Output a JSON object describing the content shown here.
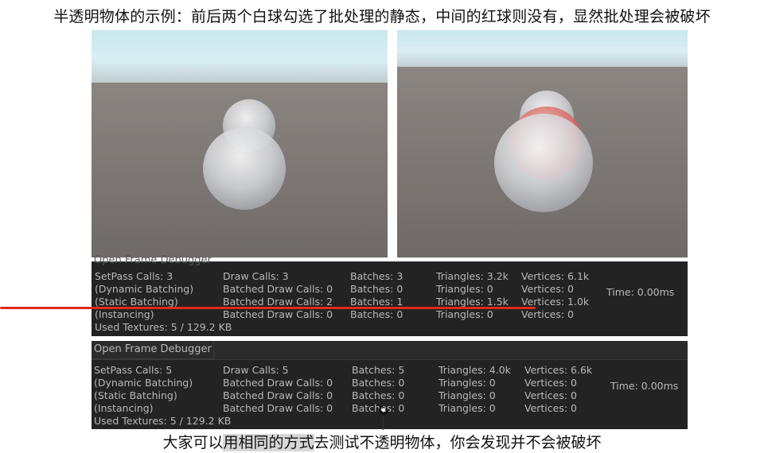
{
  "caption_top": "半透明物体的示例：前后两个白球勾选了批处理的静态，中间的红球则没有，显然批处理会被破坏",
  "caption_bottom": {
    "before": "大家可以",
    "highlight": "用相同的方式",
    "after": "去测试不透明物体，你会发现并不会被破坏"
  },
  "stats_panels": [
    {
      "header": "Open Frame Debugger",
      "rows": [
        [
          "SetPass Calls: 3",
          "Draw Calls: 3",
          "Batches: 3",
          "Triangles: 3.2k",
          "Vertices: 6.1k",
          ""
        ],
        [
          "(Dynamic Batching)",
          "Batched Draw Calls: 0",
          "Batches: 0",
          "Triangles: 0",
          "Vertices: 0",
          "Time: 0.00ms"
        ],
        [
          "(Static Batching)",
          "Batched Draw Calls: 2",
          "Batches: 1",
          "Triangles: 1.5k",
          "Vertices: 1.0k",
          ""
        ],
        [
          "(Instancing)",
          "Batched Draw Calls: 0",
          "Batches: 0",
          "Triangles: 0",
          "Vertices: 0",
          ""
        ],
        [
          "Used Textures: 5 / 129.2 KB",
          "",
          "",
          "",
          "",
          ""
        ]
      ]
    },
    {
      "header": "Open Frame Debugger",
      "rows": [
        [
          "SetPass Calls: 5",
          "Draw Calls: 5",
          "Batches: 5",
          "Triangles: 4.0k",
          "Vertices: 6.6k",
          ""
        ],
        [
          "(Dynamic Batching)",
          "Batched Draw Calls: 0",
          "Batches: 0",
          "Triangles: 0",
          "Vertices: 0",
          "Time: 0.00ms"
        ],
        [
          "(Static Batching)",
          "Batched Draw Calls: 0",
          "Batches: 0",
          "Triangles: 0",
          "Vertices: 0",
          ""
        ],
        [
          "(Instancing)",
          "Batched Draw Calls: 0",
          "Batches: 0",
          "Triangles: 0",
          "Vertices: 0",
          ""
        ],
        [
          "Used Textures: 5 / 129.2 KB",
          "",
          "",
          "",
          "",
          ""
        ]
      ]
    }
  ],
  "colors": {
    "panel_bg": "#232323",
    "panel_text": "#b9b9b9",
    "underline": "#e02a1a",
    "sky_top": "#b9dfe9",
    "ground": "#7a7572",
    "red_sphere": "#d96a66"
  },
  "icons": [
    "loading-cursor-icon"
  ]
}
